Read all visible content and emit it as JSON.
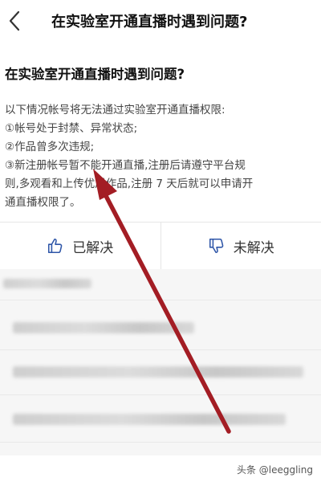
{
  "header": {
    "back_icon": "chevron-left-icon",
    "title": "在实验室开通直播时遇到问题?"
  },
  "article": {
    "title": "在实验室开通直播时遇到问题?",
    "lines": [
      "以下情况帐号将无法通过实验室开通直播权限:",
      "①帐号处于封禁、异常状态;",
      "②作品曾多次违规;",
      "③新注册帐号暂不能开通直播,注册后请遵守平台规",
      "则,多观看和上传优质作品,注册 7 天后就可以申请开",
      "通直播权限了。"
    ]
  },
  "feedback": {
    "resolved_label": "已解决",
    "resolved_icon": "thumbs-up-icon",
    "unresolved_label": "未解决",
    "unresolved_icon": "thumbs-down-icon"
  },
  "annotation": {
    "arrow_color": "#a31d24"
  },
  "watermark": "头条 @leeggling"
}
